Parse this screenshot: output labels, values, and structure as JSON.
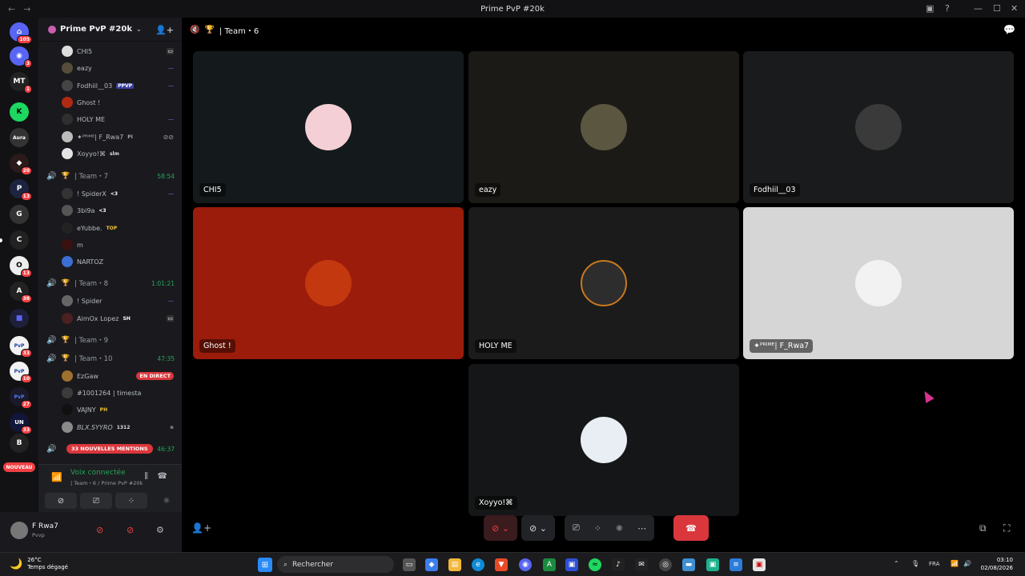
{
  "window": {
    "title": "Prime PvP #20k"
  },
  "servers": [
    {
      "icon": "discord-home-icon",
      "badge": "105"
    },
    {
      "icon": "discord-icon",
      "badge": "3"
    },
    {
      "icon": "server-mt-icon",
      "badge": "1"
    },
    {
      "icon": "server-k-icon",
      "badge": ""
    },
    {
      "icon": "server-aura-icon",
      "badge": ""
    },
    {
      "icon": "server-dark-icon",
      "badge": "20"
    },
    {
      "icon": "server-p-icon",
      "badge": "13"
    },
    {
      "icon": "server-g-icon",
      "badge": ""
    },
    {
      "icon": "server-c-icon",
      "badge": ""
    },
    {
      "icon": "server-o-icon",
      "badge": "13"
    },
    {
      "icon": "server-a-icon",
      "badge": "38"
    },
    {
      "icon": "folder-icon",
      "badge": ""
    },
    {
      "icon": "server-pvp-icon",
      "badge": "33"
    },
    {
      "icon": "server-pvp2-icon",
      "badge": "10"
    },
    {
      "icon": "server-pvp3-icon",
      "badge": "27"
    },
    {
      "icon": "server-un-icon",
      "badge": "33"
    },
    {
      "icon": "server-b-icon",
      "badge": ""
    }
  ],
  "nouveau": "NOUVEAU",
  "guild": {
    "name": "Prime PvP #20k"
  },
  "voice_users_top": [
    {
      "name": "CHI5",
      "tag": "",
      "status_icon": "screen-icon"
    },
    {
      "name": "eazy",
      "tag": "",
      "status_icon": "deafen-icon"
    },
    {
      "name": "Fodhiil__03",
      "tag": "PPVP",
      "status_icon": "deafen-icon"
    },
    {
      "name": "Ghost !",
      "tag": "",
      "status_icon": ""
    },
    {
      "name": "HOLY ME",
      "tag": "",
      "status_icon": "deafen-icon"
    },
    {
      "name": "✦ᴾᴿᴵᴹᴱ| F_Rwa7",
      "tag": "PI",
      "status_icon": "muted-icon"
    },
    {
      "name": "Xoyyo!⌘",
      "tag": "slm",
      "status_icon": ""
    }
  ],
  "team7": {
    "label": "| Team・7",
    "time": "58:54"
  },
  "team7_users": [
    {
      "name": "! SpiderX",
      "tag": "<3",
      "status_icon": "deafen-icon"
    },
    {
      "name": "3bi9a",
      "tag": "<3",
      "status_icon": ""
    },
    {
      "name": "eYubbe.",
      "tag": "TOP",
      "status_icon": ""
    },
    {
      "name": "m",
      "tag": "",
      "status_icon": ""
    },
    {
      "name": "NARTOZ",
      "tag": "",
      "status_icon": ""
    }
  ],
  "team8": {
    "label": "| Team・8",
    "time": "1:01:21"
  },
  "team8_users": [
    {
      "name": "! Spider",
      "tag": "",
      "status_icon": "deafen-icon"
    },
    {
      "name": "AimOx Lopez",
      "tag": "SH",
      "status_icon": "screen-icon"
    }
  ],
  "team9": {
    "label": "| Team・9",
    "time": ""
  },
  "team10": {
    "label": "| Team・10",
    "time": "47:35"
  },
  "team10_users": [
    {
      "name": "EzGaw",
      "tag": "",
      "live": "EN DIRECT"
    },
    {
      "name": "#1001264 | timesta",
      "tag": "",
      "live": ""
    },
    {
      "name": "VAJNY",
      "tag": "PH",
      "live": ""
    },
    {
      "name": "BLX.SYYRO",
      "tag": "1312",
      "live": ""
    }
  ],
  "team_next": {
    "time": "46:37"
  },
  "mentions": "33 NOUVELLES MENTIONS",
  "voice_panel": {
    "status": "Voix connectée",
    "sub": "| Team・6 / Prime PvP #20k"
  },
  "user_panel": {
    "name": "F Rwa7",
    "status": "Pvvp"
  },
  "main": {
    "channel": "| Team・6"
  },
  "tiles": [
    {
      "name": "CHI5",
      "bg": "#141a1b"
    },
    {
      "name": "eazy",
      "bg": "#1c1a16"
    },
    {
      "name": "Fodhiil__03",
      "bg": "#1a1b1c"
    },
    {
      "name": "Ghost !",
      "bg": "#9b1c0a"
    },
    {
      "name": "HOLY ME",
      "bg": "#1b1b1c"
    },
    {
      "name": "✦ᴾᴿᴵᴹᴱ| F_Rwa7",
      "bg": "#d6d6d6"
    },
    {
      "name": "Xoyyo!⌘",
      "bg": "#151617"
    }
  ],
  "taskbar": {
    "temp": "26°C",
    "weather": "Temps dégagé",
    "search": "Rechercher",
    "lang": "FRA",
    "time": "03:10",
    "date": "02/08/2026"
  }
}
